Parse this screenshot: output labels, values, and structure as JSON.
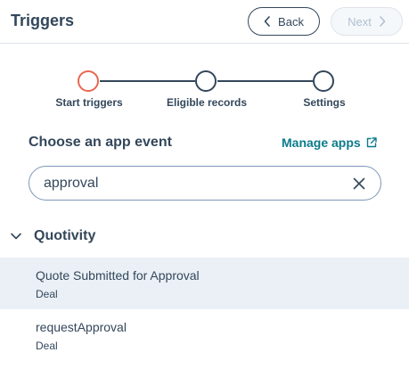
{
  "header": {
    "title": "Triggers",
    "back_label": "Back",
    "next_label": "Next"
  },
  "stepper": {
    "steps": [
      {
        "label": "Start triggers",
        "state": "active"
      },
      {
        "label": "Eligible records",
        "state": "pending"
      },
      {
        "label": "Settings",
        "state": "pending"
      }
    ]
  },
  "event_section": {
    "heading": "Choose an app event",
    "manage_link": "Manage apps"
  },
  "search": {
    "value": "approval"
  },
  "results": {
    "group_name": "Quotivity",
    "items": [
      {
        "title": "Quote Submitted for Approval",
        "subtitle": "Deal",
        "selected": true
      },
      {
        "title": "requestApproval",
        "subtitle": "Deal",
        "selected": false
      }
    ]
  },
  "colors": {
    "text": "#33475b",
    "active_step": "#e8674f",
    "link": "#0b7b8b",
    "selected_row": "#eaf0f6"
  }
}
